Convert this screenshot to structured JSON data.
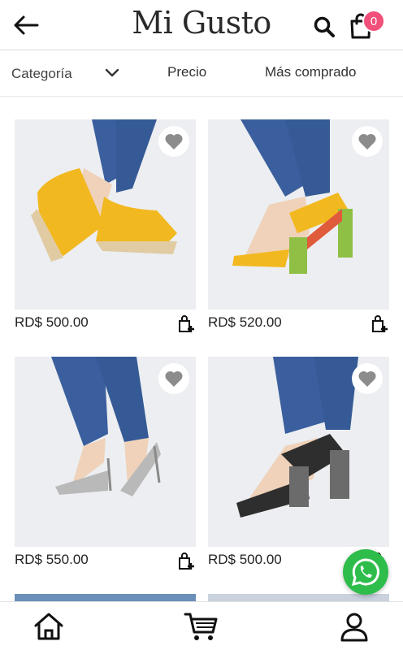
{
  "header": {
    "brand": "Mi Gusto",
    "cart_count": "0",
    "icons": {
      "back": "arrow-left-icon",
      "search": "search-icon",
      "bag": "shopping-bag-icon"
    }
  },
  "filters": {
    "category": "Categoría",
    "price": "Precio",
    "best_selling": "Más comprado"
  },
  "products": [
    {
      "price": "RD$ 500.00",
      "shoe_color": "#f2b81f",
      "accent": "#e0cba3"
    },
    {
      "price": "RD$ 520.00",
      "shoe_color": "#f2b81f",
      "accent": "#8fc045"
    },
    {
      "price": "RD$ 550.00",
      "shoe_color": "#b9b9b9",
      "accent": "#8a8a8a"
    },
    {
      "price": "RD$ 500.00",
      "shoe_color": "#2e2e2e",
      "accent": "#6b6b6b"
    }
  ],
  "colors": {
    "badge": "#f0507a",
    "whatsapp": "#2ebd4b",
    "jeans": "#3b5f9e"
  },
  "bottom_nav": {
    "icons": [
      "home-icon",
      "cart-icon",
      "user-icon"
    ]
  }
}
